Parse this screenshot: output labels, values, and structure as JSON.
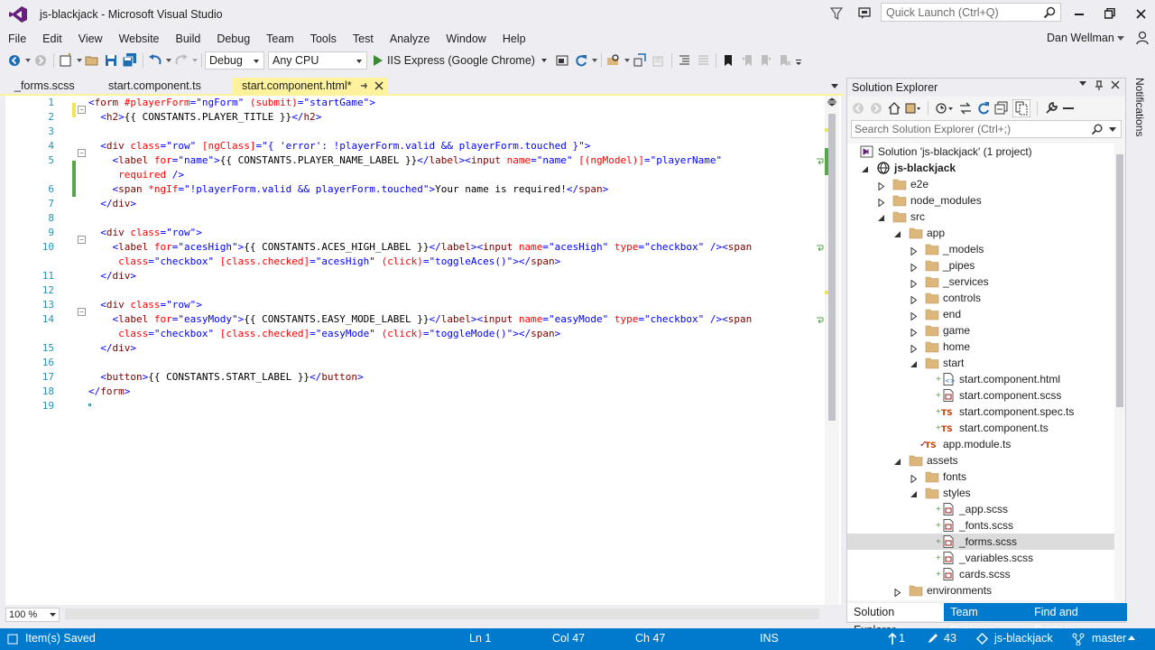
{
  "window": {
    "title": "js-blackjack - Microsoft Visual Studio",
    "quick_launch_placeholder": "Quick Launch (Ctrl+Q)"
  },
  "menu": [
    "File",
    "Edit",
    "View",
    "Website",
    "Build",
    "Debug",
    "Team",
    "Tools",
    "Test",
    "Analyze",
    "Window",
    "Help"
  ],
  "user": "Dan Wellman",
  "toolbar": {
    "config": "Debug",
    "platform": "Any CPU",
    "run_target": "IIS Express (Google Chrome)"
  },
  "tabs": [
    {
      "label": "_forms.scss",
      "active": false
    },
    {
      "label": "start.component.ts",
      "active": false
    },
    {
      "label": "start.component.html*",
      "active": true
    }
  ],
  "editor": {
    "zoom": "100 %",
    "lines": [
      {
        "n": "1",
        "tokens": [
          [
            "b",
            "<"
          ],
          [
            "k",
            "form"
          ],
          [
            "t",
            " "
          ],
          [
            "a",
            "#playerForm"
          ],
          [
            "b",
            "="
          ],
          [
            "s",
            "\"ngForm\""
          ],
          [
            "t",
            " "
          ],
          [
            "a",
            "(submit)"
          ],
          [
            "b",
            "="
          ],
          [
            "s",
            "\"startGame\""
          ],
          [
            "b",
            ">"
          ]
        ]
      },
      {
        "n": "2",
        "tokens": [
          [
            "t",
            "  "
          ],
          [
            "b",
            "<"
          ],
          [
            "k",
            "h2"
          ],
          [
            "b",
            ">"
          ],
          [
            "t",
            "{{ CONSTANTS.PLAYER_TITLE }}"
          ],
          [
            "b",
            "</"
          ],
          [
            "k",
            "h2"
          ],
          [
            "b",
            ">"
          ]
        ]
      },
      {
        "n": "3",
        "tokens": []
      },
      {
        "n": "4",
        "tokens": [
          [
            "t",
            "  "
          ],
          [
            "b",
            "<"
          ],
          [
            "k",
            "div"
          ],
          [
            "t",
            " "
          ],
          [
            "a",
            "class"
          ],
          [
            "b",
            "="
          ],
          [
            "s",
            "\"row\""
          ],
          [
            "t",
            " "
          ],
          [
            "a",
            "[ngClass]"
          ],
          [
            "b",
            "="
          ],
          [
            "s",
            "\"{ 'error': !playerForm.valid && playerForm.touched }\""
          ],
          [
            "b",
            ">"
          ]
        ]
      },
      {
        "n": "5",
        "tokens": [
          [
            "t",
            "    "
          ],
          [
            "b",
            "<"
          ],
          [
            "k",
            "label"
          ],
          [
            "t",
            " "
          ],
          [
            "a",
            "for"
          ],
          [
            "b",
            "="
          ],
          [
            "s",
            "\"name\""
          ],
          [
            "b",
            ">"
          ],
          [
            "t",
            "{{ CONSTANTS.PLAYER_NAME_LABEL }}"
          ],
          [
            "b",
            "</"
          ],
          [
            "k",
            "label"
          ],
          [
            "b",
            "><"
          ],
          [
            "k",
            "input"
          ],
          [
            "t",
            " "
          ],
          [
            "a",
            "name"
          ],
          [
            "b",
            "="
          ],
          [
            "s",
            "\"name\""
          ],
          [
            "t",
            " "
          ],
          [
            "a",
            "[(ngModel)]"
          ],
          [
            "b",
            "="
          ],
          [
            "s",
            "\"playerName\""
          ]
        ]
      },
      {
        "n": "",
        "tokens": [
          [
            "t",
            "     "
          ],
          [
            "a",
            "required"
          ],
          [
            "t",
            " "
          ],
          [
            "b",
            "/>"
          ]
        ]
      },
      {
        "n": "6",
        "tokens": [
          [
            "t",
            "    "
          ],
          [
            "b",
            "<"
          ],
          [
            "k",
            "span"
          ],
          [
            "t",
            " "
          ],
          [
            "a",
            "*ngIf"
          ],
          [
            "b",
            "="
          ],
          [
            "s",
            "\"!playerForm.valid && playerForm.touched\""
          ],
          [
            "b",
            ">"
          ],
          [
            "t",
            "Your name is required!"
          ],
          [
            "b",
            "</"
          ],
          [
            "k",
            "span"
          ],
          [
            "b",
            ">"
          ]
        ]
      },
      {
        "n": "7",
        "tokens": [
          [
            "t",
            "  "
          ],
          [
            "b",
            "</"
          ],
          [
            "k",
            "div"
          ],
          [
            "b",
            ">"
          ]
        ]
      },
      {
        "n": "8",
        "tokens": []
      },
      {
        "n": "9",
        "tokens": [
          [
            "t",
            "  "
          ],
          [
            "b",
            "<"
          ],
          [
            "k",
            "div"
          ],
          [
            "t",
            " "
          ],
          [
            "a",
            "class"
          ],
          [
            "b",
            "="
          ],
          [
            "s",
            "\"row\""
          ],
          [
            "b",
            ">"
          ]
        ]
      },
      {
        "n": "10",
        "tokens": [
          [
            "t",
            "    "
          ],
          [
            "b",
            "<"
          ],
          [
            "k",
            "label"
          ],
          [
            "t",
            " "
          ],
          [
            "a",
            "for"
          ],
          [
            "b",
            "="
          ],
          [
            "s",
            "\"acesHigh\""
          ],
          [
            "b",
            ">"
          ],
          [
            "t",
            "{{ CONSTANTS.ACES_HIGH_LABEL }}"
          ],
          [
            "b",
            "</"
          ],
          [
            "k",
            "label"
          ],
          [
            "b",
            "><"
          ],
          [
            "k",
            "input"
          ],
          [
            "t",
            " "
          ],
          [
            "a",
            "name"
          ],
          [
            "b",
            "="
          ],
          [
            "s",
            "\"acesHigh\""
          ],
          [
            "t",
            " "
          ],
          [
            "a",
            "type"
          ],
          [
            "b",
            "="
          ],
          [
            "s",
            "\"checkbox\""
          ],
          [
            "t",
            " "
          ],
          [
            "b",
            "/><"
          ],
          [
            "k",
            "span"
          ]
        ]
      },
      {
        "n": "",
        "tokens": [
          [
            "t",
            "     "
          ],
          [
            "a",
            "class"
          ],
          [
            "b",
            "="
          ],
          [
            "s",
            "\"checkbox\""
          ],
          [
            "t",
            " "
          ],
          [
            "a",
            "[class.checked]"
          ],
          [
            "b",
            "="
          ],
          [
            "s",
            "\"acesHigh\""
          ],
          [
            "t",
            " "
          ],
          [
            "a",
            "(click)"
          ],
          [
            "b",
            "="
          ],
          [
            "s",
            "\"toggleAces()\""
          ],
          [
            "b",
            "></"
          ],
          [
            "k",
            "span"
          ],
          [
            "b",
            ">"
          ]
        ]
      },
      {
        "n": "11",
        "tokens": [
          [
            "t",
            "  "
          ],
          [
            "b",
            "</"
          ],
          [
            "k",
            "div"
          ],
          [
            "b",
            ">"
          ]
        ]
      },
      {
        "n": "12",
        "tokens": []
      },
      {
        "n": "13",
        "tokens": [
          [
            "t",
            "  "
          ],
          [
            "b",
            "<"
          ],
          [
            "k",
            "div"
          ],
          [
            "t",
            " "
          ],
          [
            "a",
            "class"
          ],
          [
            "b",
            "="
          ],
          [
            "s",
            "\"row\""
          ],
          [
            "b",
            ">"
          ]
        ]
      },
      {
        "n": "14",
        "tokens": [
          [
            "t",
            "    "
          ],
          [
            "b",
            "<"
          ],
          [
            "k",
            "label"
          ],
          [
            "t",
            " "
          ],
          [
            "a",
            "for"
          ],
          [
            "b",
            "="
          ],
          [
            "s",
            "\"easyMody\""
          ],
          [
            "b",
            ">"
          ],
          [
            "t",
            "{{ CONSTANTS.EASY_MODE_LABEL }}"
          ],
          [
            "b",
            "</"
          ],
          [
            "k",
            "label"
          ],
          [
            "b",
            "><"
          ],
          [
            "k",
            "input"
          ],
          [
            "t",
            " "
          ],
          [
            "a",
            "name"
          ],
          [
            "b",
            "="
          ],
          [
            "s",
            "\"easyMode\""
          ],
          [
            "t",
            " "
          ],
          [
            "a",
            "type"
          ],
          [
            "b",
            "="
          ],
          [
            "s",
            "\"checkbox\""
          ],
          [
            "t",
            " "
          ],
          [
            "b",
            "/><"
          ],
          [
            "k",
            "span"
          ]
        ]
      },
      {
        "n": "",
        "tokens": [
          [
            "t",
            "     "
          ],
          [
            "a",
            "class"
          ],
          [
            "b",
            "="
          ],
          [
            "s",
            "\"checkbox\""
          ],
          [
            "t",
            " "
          ],
          [
            "a",
            "[class.checked]"
          ],
          [
            "b",
            "="
          ],
          [
            "s",
            "\"easyMode\""
          ],
          [
            "t",
            " "
          ],
          [
            "a",
            "(click)"
          ],
          [
            "b",
            "="
          ],
          [
            "s",
            "\"toggleMode()\""
          ],
          [
            "b",
            "></"
          ],
          [
            "k",
            "span"
          ],
          [
            "b",
            ">"
          ]
        ]
      },
      {
        "n": "15",
        "tokens": [
          [
            "t",
            "  "
          ],
          [
            "b",
            "</"
          ],
          [
            "k",
            "div"
          ],
          [
            "b",
            ">"
          ]
        ]
      },
      {
        "n": "16",
        "tokens": []
      },
      {
        "n": "17",
        "tokens": [
          [
            "t",
            "  "
          ],
          [
            "b",
            "<"
          ],
          [
            "k",
            "button"
          ],
          [
            "b",
            ">"
          ],
          [
            "t",
            "{{ CONSTANTS.START_LABEL }}"
          ],
          [
            "b",
            "</"
          ],
          [
            "k",
            "button"
          ],
          [
            "b",
            ">"
          ]
        ]
      },
      {
        "n": "18",
        "tokens": [
          [
            "b",
            "</"
          ],
          [
            "k",
            "form"
          ],
          [
            "b",
            ">"
          ]
        ]
      },
      {
        "n": "19",
        "tokens": []
      }
    ]
  },
  "solution_explorer": {
    "title": "Solution Explorer",
    "search_placeholder": "Search Solution Explorer (Ctrl+;)",
    "nodes": [
      {
        "label": "Solution 'js-blackjack' (1 project)",
        "level": 0,
        "icon": "solution",
        "exp": "none"
      },
      {
        "label": "js-blackjack",
        "level": 1,
        "icon": "web",
        "exp": "open",
        "bold": true
      },
      {
        "label": "e2e",
        "level": 2,
        "icon": "folder",
        "exp": "closed"
      },
      {
        "label": "node_modules",
        "level": 2,
        "icon": "folder",
        "exp": "closed"
      },
      {
        "label": "src",
        "level": 2,
        "icon": "folder",
        "exp": "open"
      },
      {
        "label": "app",
        "level": 3,
        "icon": "folder",
        "exp": "open"
      },
      {
        "label": "_models",
        "level": 4,
        "icon": "folder",
        "exp": "closed"
      },
      {
        "label": "_pipes",
        "level": 4,
        "icon": "folder",
        "exp": "closed"
      },
      {
        "label": "_services",
        "level": 4,
        "icon": "folder",
        "exp": "closed"
      },
      {
        "label": "controls",
        "level": 4,
        "icon": "folder",
        "exp": "closed"
      },
      {
        "label": "end",
        "level": 4,
        "icon": "folder",
        "exp": "closed"
      },
      {
        "label": "game",
        "level": 4,
        "icon": "folder",
        "exp": "closed"
      },
      {
        "label": "home",
        "level": 4,
        "icon": "folder",
        "exp": "closed"
      },
      {
        "label": "start",
        "level": 4,
        "icon": "folder",
        "exp": "open"
      },
      {
        "label": "start.component.html",
        "level": 5,
        "icon": "html",
        "exp": "none"
      },
      {
        "label": "start.component.scss",
        "level": 5,
        "icon": "scss",
        "exp": "none"
      },
      {
        "label": "start.component.spec.ts",
        "level": 5,
        "icon": "ts",
        "exp": "none"
      },
      {
        "label": "start.component.ts",
        "level": 5,
        "icon": "ts",
        "exp": "none"
      },
      {
        "label": "app.module.ts",
        "level": 4,
        "icon": "ts",
        "exp": "none",
        "check": true
      },
      {
        "label": "assets",
        "level": 3,
        "icon": "folder",
        "exp": "open"
      },
      {
        "label": "fonts",
        "level": 4,
        "icon": "folder",
        "exp": "closed"
      },
      {
        "label": "styles",
        "level": 4,
        "icon": "folder",
        "exp": "open"
      },
      {
        "label": "_app.scss",
        "level": 5,
        "icon": "scss",
        "exp": "none"
      },
      {
        "label": "_fonts.scss",
        "level": 5,
        "icon": "scss",
        "exp": "none"
      },
      {
        "label": "_forms.scss",
        "level": 5,
        "icon": "scss",
        "exp": "none",
        "selected": true
      },
      {
        "label": "_variables.scss",
        "level": 5,
        "icon": "scss",
        "exp": "none"
      },
      {
        "label": "cards.scss",
        "level": 5,
        "icon": "scss",
        "exp": "none"
      },
      {
        "label": "environments",
        "level": 3,
        "icon": "folder",
        "exp": "closed"
      }
    ],
    "bottom_tabs": [
      "Solution Explorer",
      "Team Explorer",
      "Find and Replace"
    ]
  },
  "notifications_label": "Notifications",
  "status": {
    "message": "Item(s) Saved",
    "ln": "Ln 1",
    "col": "Col 47",
    "ch": "Ch 47",
    "mode": "INS",
    "up": "1",
    "pencil": "43",
    "repo": "js-blackjack",
    "branch": "master"
  },
  "colors": {
    "accent": "#007acc",
    "tab_active": "#fff29d",
    "tag": "#800000",
    "attr": "#ff0000",
    "string": "#0000ff",
    "line_no": "#2b91af",
    "change_saved": "#57a64a",
    "change_unsaved": "#f2e25c"
  }
}
